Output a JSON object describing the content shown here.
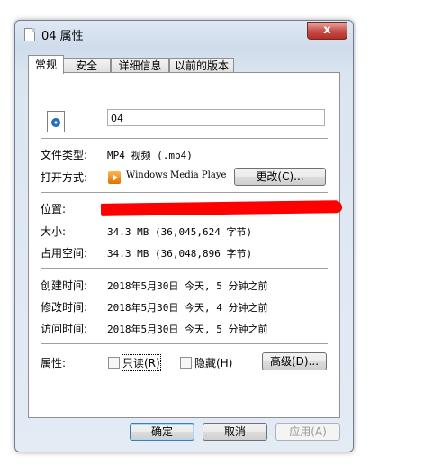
{
  "window": {
    "title": "04 属性",
    "close_label": "x"
  },
  "tabs": [
    {
      "label": "常规",
      "active": true
    },
    {
      "label": "安全",
      "active": false
    },
    {
      "label": "详细信息",
      "active": false
    },
    {
      "label": "以前的版本",
      "active": false
    }
  ],
  "general": {
    "file_name": "04",
    "file_type_label": "文件类型:",
    "file_type_value": "MP4 视频 (.mp4)",
    "open_with_label": "打开方式:",
    "open_with_value": "Windows Media Playe",
    "change_button": "更改(C)...",
    "location_label": "位置:",
    "size_label": "大小:",
    "size_value": "34.3 MB (36,045,624 字节)",
    "disk_size_label": "占用空间:",
    "disk_size_value": "34.3 MB (36,048,896 字节)",
    "created_label": "创建时间:",
    "created_value": "2018年5月30日 今天, 5 分钟之前",
    "modified_label": "修改时间:",
    "modified_value": "2018年5月30日 今天, 4 分钟之前",
    "accessed_label": "访问时间:",
    "accessed_value": "2018年5月30日 今天, 5 分钟之前",
    "attributes_label": "属性:",
    "readonly_label": "只读(R)",
    "hidden_label": "隐藏(H)",
    "advanced_button": "高级(D)..."
  },
  "footer": {
    "ok": "确定",
    "cancel": "取消",
    "apply": "应用(A)"
  },
  "colors": {
    "redaction": "#ff0000",
    "close_button": "#c75050"
  }
}
